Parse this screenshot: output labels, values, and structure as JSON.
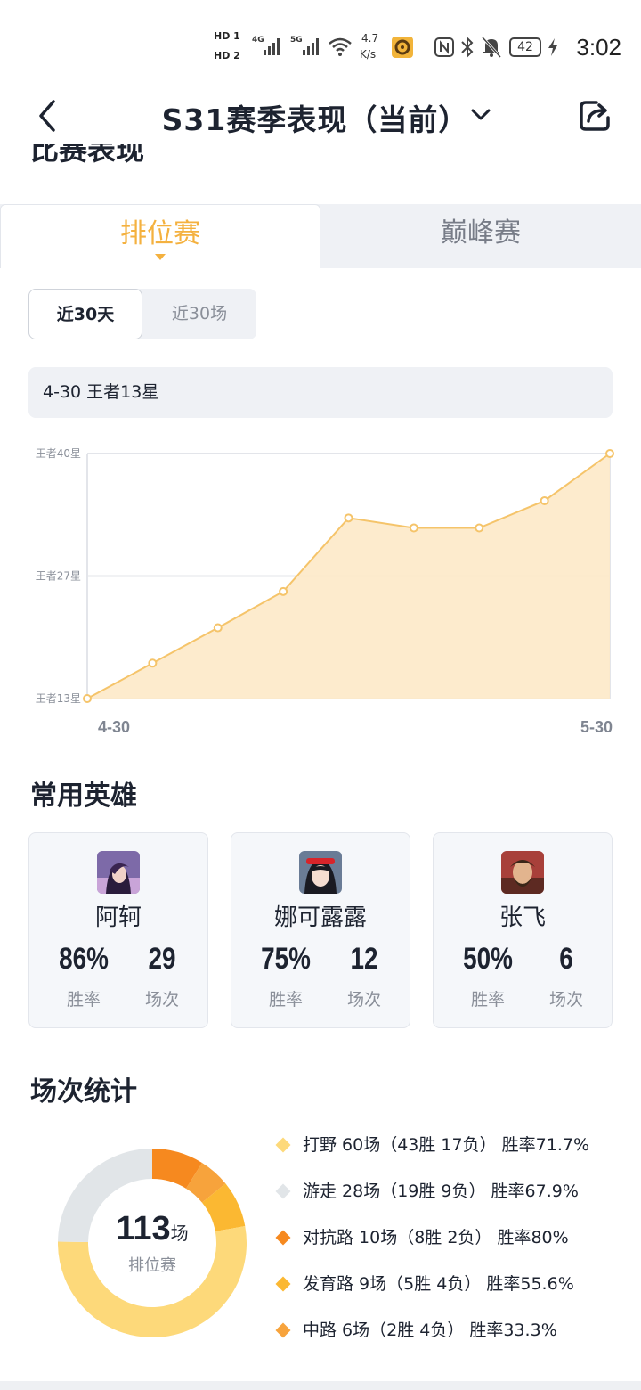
{
  "status_bar": {
    "time": "3:02",
    "network_speed_top": "4.7",
    "network_speed_bottom": "K/s",
    "battery": "42",
    "hd1": "HD 1",
    "hd2": "HD 2",
    "net1": "4G",
    "net2": "5G"
  },
  "header": {
    "title": "S31赛季表现（当前）"
  },
  "section_match": {
    "title_clipped": "比赛表现"
  },
  "tabs": [
    {
      "label": "排位赛",
      "active": true
    },
    {
      "label": "巅峰赛",
      "active": false
    }
  ],
  "segments": [
    {
      "label": "近30天",
      "active": true
    },
    {
      "label": "近30场",
      "active": false
    }
  ],
  "info_box": "4-30 王者13星",
  "chart_data": {
    "type": "area",
    "y_ticks": [
      "王者40星",
      "王者27星",
      "王者13星"
    ],
    "ylim": [
      13,
      40
    ],
    "x_labels": [
      "4-30",
      "5-30"
    ],
    "values": [
      13,
      16.9,
      20.8,
      24.8,
      32.9,
      31.8,
      31.8,
      34.8,
      40
    ],
    "colors": {
      "line": "#f5c46a",
      "fill": "#fde9c8",
      "grid": "#e3e5ea"
    }
  },
  "heroes_section": {
    "title": "常用英雄",
    "heroes": [
      {
        "name": "阿轲",
        "winrate": "86%",
        "games": "29",
        "winrate_label": "胜率",
        "games_label": "场次"
      },
      {
        "name": "娜可露露",
        "winrate": "75%",
        "games": "12",
        "winrate_label": "胜率",
        "games_label": "场次"
      },
      {
        "name": "张飞",
        "winrate": "50%",
        "games": "6",
        "winrate_label": "胜率",
        "games_label": "场次"
      }
    ]
  },
  "stats_section": {
    "title": "场次统计",
    "total": "113",
    "total_unit": "场",
    "total_label": "排位赛",
    "legend": [
      {
        "text": "打野 60场（43胜 17负） 胜率71.7%",
        "games": 60,
        "color": "#fdd97a"
      },
      {
        "text": "游走 28场（19胜 9负） 胜率67.9%",
        "games": 28,
        "color": "#e1e5e8"
      },
      {
        "text": "对抗路 10场（8胜 2负） 胜率80%",
        "games": 10,
        "color": "#f6891f"
      },
      {
        "text": "发育路 9场（5胜 4负） 胜率55.6%",
        "games": 9,
        "color": "#fbb832"
      },
      {
        "text": "中路 6场（2胜 4负） 胜率33.3%",
        "games": 6,
        "color": "#f7a33c"
      }
    ]
  }
}
